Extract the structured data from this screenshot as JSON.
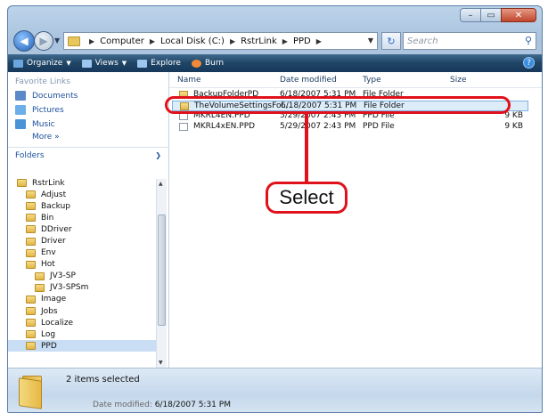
{
  "window": {
    "controls": {
      "minimize": "–",
      "maximize": "▭",
      "close": "✕"
    }
  },
  "nav": {
    "back": "◀",
    "forward": "▶"
  },
  "address": {
    "crumbs": [
      "Computer",
      "Local Disk (C:)",
      "RstrLink",
      "PPD"
    ],
    "refresh": "↻",
    "search_placeholder": "Search"
  },
  "toolbar": {
    "items": [
      "Organize",
      "Views",
      "Explore",
      "Burn"
    ],
    "icon_colors": [
      "#6aa6e0",
      "#9ec7f0",
      "#9ec7f0",
      "#f08a3a"
    ]
  },
  "favorites": {
    "title": "Favorite Links",
    "items": [
      {
        "label": "Documents",
        "icon": "documents-icon",
        "color": "#5b89c9"
      },
      {
        "label": "Pictures",
        "icon": "pictures-icon",
        "color": "#6eaee8"
      },
      {
        "label": "Music",
        "icon": "music-icon",
        "color": "#4a93d6"
      }
    ],
    "more": "More  »"
  },
  "folders": {
    "title": "Folders",
    "tree": [
      {
        "label": "RstrLink",
        "indent": 0,
        "selected": false
      },
      {
        "label": "Adjust",
        "indent": 1,
        "selected": false
      },
      {
        "label": "Backup",
        "indent": 1,
        "selected": false
      },
      {
        "label": "Bin",
        "indent": 1,
        "selected": false
      },
      {
        "label": "DDriver",
        "indent": 1,
        "selected": false
      },
      {
        "label": "Driver",
        "indent": 1,
        "selected": false
      },
      {
        "label": "Env",
        "indent": 1,
        "selected": false
      },
      {
        "label": "Hot",
        "indent": 1,
        "selected": false
      },
      {
        "label": "JV3-SP",
        "indent": 2,
        "selected": false
      },
      {
        "label": "JV3-SPSm",
        "indent": 2,
        "selected": false
      },
      {
        "label": "Image",
        "indent": 1,
        "selected": false
      },
      {
        "label": "Jobs",
        "indent": 1,
        "selected": false
      },
      {
        "label": "Localize",
        "indent": 1,
        "selected": false
      },
      {
        "label": "Log",
        "indent": 1,
        "selected": false
      },
      {
        "label": "PPD",
        "indent": 1,
        "selected": true
      }
    ]
  },
  "columns": {
    "name": "Name",
    "date": "Date modified",
    "type": "Type",
    "size": "Size"
  },
  "files": [
    {
      "name": "BackupFolderPD",
      "date": "6/18/2007 5:31 PM",
      "type": "File Folder",
      "size": "",
      "kind": "folder",
      "selected": true
    },
    {
      "name": "TheVolumeSettingsFol...",
      "date": "6/18/2007 5:31 PM",
      "type": "File Folder",
      "size": "",
      "kind": "folder",
      "selected": true
    },
    {
      "name": "MKRL4EN.PPD",
      "date": "5/29/2007 2:43 PM",
      "type": "PPD File",
      "size": "9 KB",
      "kind": "file",
      "selected": false
    },
    {
      "name": "MKRL4xEN.PPD",
      "date": "5/29/2007 2:43 PM",
      "type": "PPD File",
      "size": "9 KB",
      "kind": "file",
      "selected": false
    }
  ],
  "status": {
    "count": "2 items selected",
    "date_label": "Date modified:",
    "date_value": "6/18/2007 5:31 PM"
  },
  "callout": {
    "label": "Select",
    "color": "#e0111b"
  }
}
